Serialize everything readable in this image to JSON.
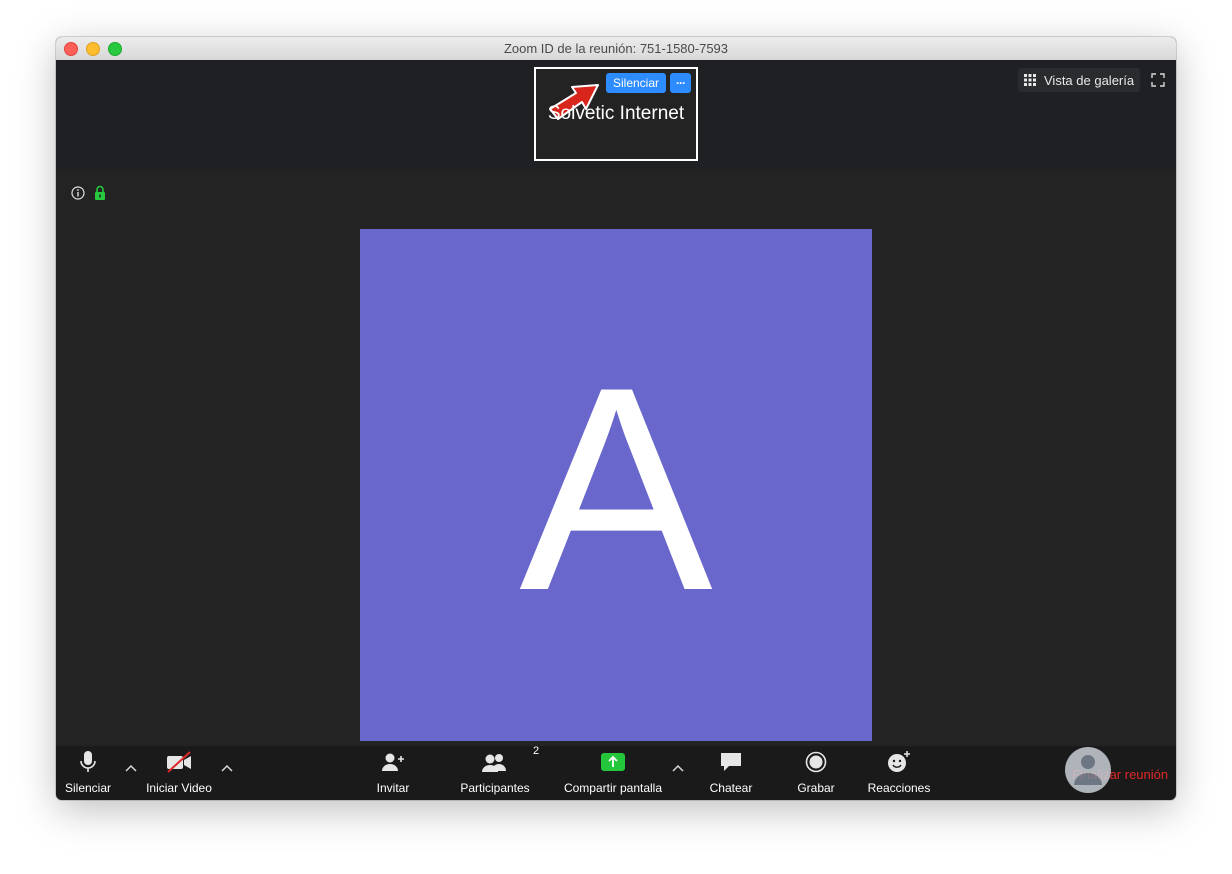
{
  "window": {
    "title": "Zoom ID de la reunión: 751-1580-7593"
  },
  "speaker": {
    "name": "Solvetic Internet",
    "mute_label": "Silenciar",
    "more_label": "···"
  },
  "view": {
    "gallery_label": "Vista de galería"
  },
  "participant": {
    "initial": "A",
    "avatar_color": "#6967cb"
  },
  "toolbar": {
    "mute_label": "Silenciar",
    "video_label": "Iniciar Video",
    "invite_label": "Invitar",
    "participants_label": "Participantes",
    "participants_count": "2",
    "share_label": "Compartir pantalla",
    "chat_label": "Chatear",
    "record_label": "Grabar",
    "reactions_label": "Reacciones",
    "end_label": "Finalizar reunión"
  },
  "colors": {
    "accent_blue": "#2d8cff",
    "share_green": "#24c73b",
    "end_red": "#e02828",
    "annotation_arrow": "#d9261c"
  },
  "icons": [
    "info-icon",
    "lock-icon",
    "grid-icon",
    "fullscreen-icon",
    "microphone-icon",
    "video-off-icon",
    "add-person-icon",
    "participants-icon",
    "share-screen-icon",
    "chat-icon",
    "record-icon",
    "reactions-icon"
  ]
}
